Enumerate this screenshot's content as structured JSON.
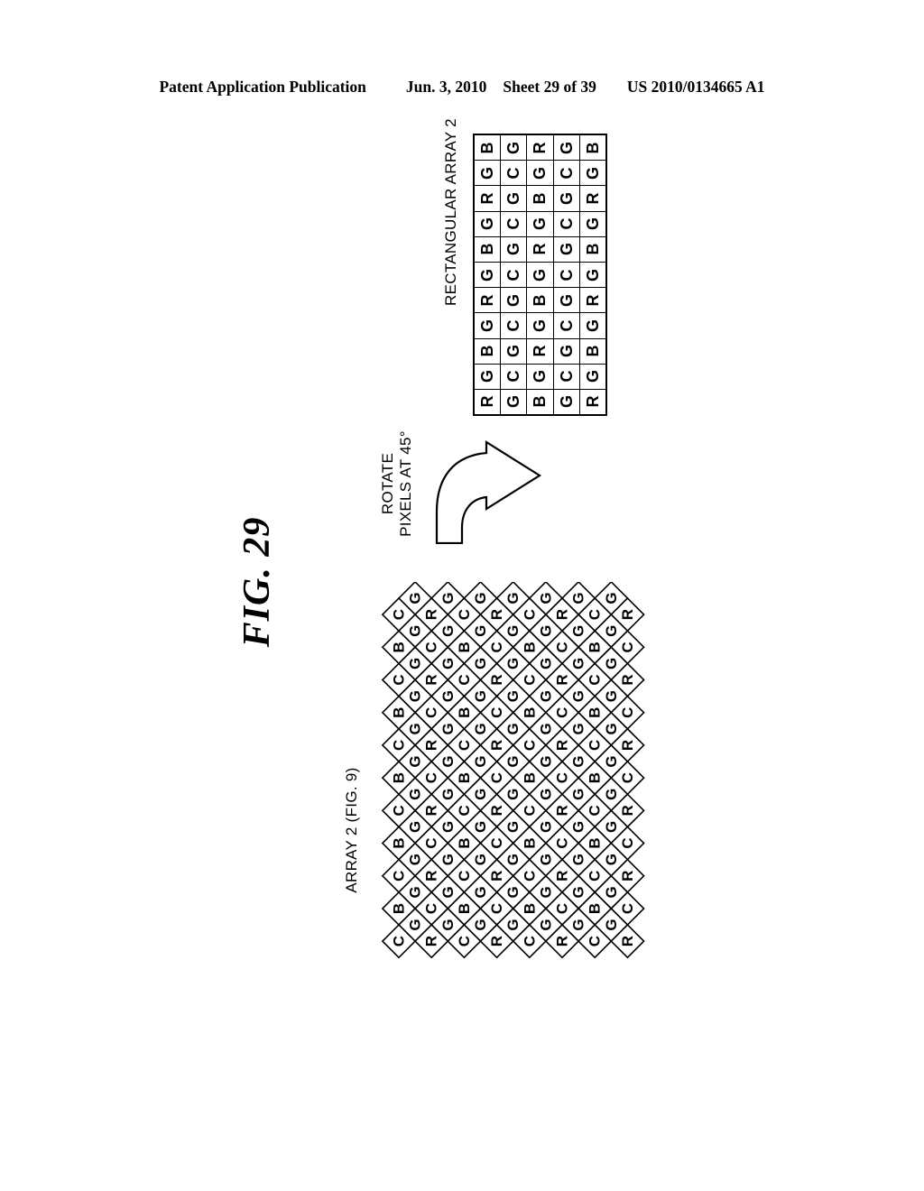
{
  "header": {
    "publication": "Patent Application Publication",
    "date": "Jun. 3, 2010",
    "sheet": "Sheet 29 of 39",
    "patent_number": "US 2010/0134665 A1"
  },
  "figure": {
    "title": "FIG. 29",
    "rotate_note_line1": "ROTATE",
    "rotate_note_line2": "PIXELS AT 45°",
    "rect_array_label": "RECTANGULAR ARRAY 2",
    "diamond_array_label": "ARRAY 2 (FIG. 9)"
  },
  "colors": {
    "ink": "#000000",
    "paper": "#ffffff"
  },
  "chart_data": {
    "type": "table",
    "title": "RECTANGULAR ARRAY 2",
    "description": "Color filter array pattern; 5 columns by 11 rows of R/G/B/C pixel labels (page-rotated 90°).",
    "columns": 5,
    "rows_count": 11,
    "rows": [
      [
        "B",
        "G",
        "R",
        "G",
        "B"
      ],
      [
        "G",
        "C",
        "G",
        "C",
        "G"
      ],
      [
        "R",
        "G",
        "B",
        "G",
        "R"
      ],
      [
        "G",
        "C",
        "G",
        "C",
        "G"
      ],
      [
        "B",
        "G",
        "R",
        "G",
        "B"
      ],
      [
        "G",
        "C",
        "G",
        "C",
        "G"
      ],
      [
        "R",
        "G",
        "B",
        "G",
        "R"
      ],
      [
        "G",
        "C",
        "G",
        "C",
        "G"
      ],
      [
        "B",
        "G",
        "R",
        "G",
        "B"
      ],
      [
        "G",
        "C",
        "G",
        "C",
        "G"
      ],
      [
        "R",
        "G",
        "B",
        "G",
        "R"
      ]
    ]
  },
  "diamond_array": {
    "label": "ARRAY 2 (FIG. 9)",
    "description": "Same color filter array with pixels rotated 45 degrees, forming a diamond lattice.",
    "cell_size": 36,
    "cols": 14,
    "rows": 22,
    "pattern_rows": [
      [
        "G",
        "G",
        "G",
        "G",
        "G",
        "G",
        "G"
      ],
      [
        "C",
        "R",
        "C",
        "R",
        "C",
        "R",
        "C",
        "R"
      ],
      [
        "G",
        "G",
        "G",
        "G",
        "G",
        "G",
        "G"
      ],
      [
        "B",
        "C",
        "B",
        "C",
        "B",
        "C",
        "B",
        "C"
      ],
      [
        "G",
        "G",
        "G",
        "G",
        "G",
        "G",
        "G"
      ],
      [
        "C",
        "R",
        "C",
        "R",
        "C",
        "R",
        "C",
        "R"
      ],
      [
        "G",
        "G",
        "G",
        "G",
        "G",
        "G",
        "G"
      ],
      [
        "B",
        "C",
        "B",
        "C",
        "B",
        "C",
        "B",
        "C"
      ],
      [
        "G",
        "G",
        "G",
        "G",
        "G",
        "G",
        "G"
      ],
      [
        "C",
        "R",
        "C",
        "R",
        "C",
        "R",
        "C",
        "R"
      ],
      [
        "G",
        "G",
        "G",
        "G",
        "G",
        "G",
        "G"
      ],
      [
        "B",
        "C",
        "B",
        "C",
        "B",
        "C",
        "B",
        "C"
      ],
      [
        "G",
        "G",
        "G",
        "G",
        "G",
        "G",
        "G"
      ],
      [
        "C",
        "R",
        "C",
        "R",
        "C",
        "R",
        "C",
        "R"
      ],
      [
        "G",
        "G",
        "G",
        "G",
        "G",
        "G",
        "G"
      ],
      [
        "B",
        "C",
        "B",
        "C",
        "B",
        "C",
        "B",
        "C"
      ],
      [
        "G",
        "G",
        "G",
        "G",
        "G",
        "G",
        "G"
      ],
      [
        "C",
        "R",
        "C",
        "R",
        "C",
        "R",
        "C",
        "R"
      ],
      [
        "G",
        "G",
        "G",
        "G",
        "G",
        "G",
        "G"
      ],
      [
        "B",
        "C",
        "B",
        "C",
        "B",
        "C",
        "B",
        "C"
      ],
      [
        "G",
        "G",
        "G",
        "G",
        "G",
        "G",
        "G"
      ],
      [
        "C",
        "R",
        "C",
        "R",
        "C",
        "R",
        "C",
        "R"
      ]
    ]
  }
}
